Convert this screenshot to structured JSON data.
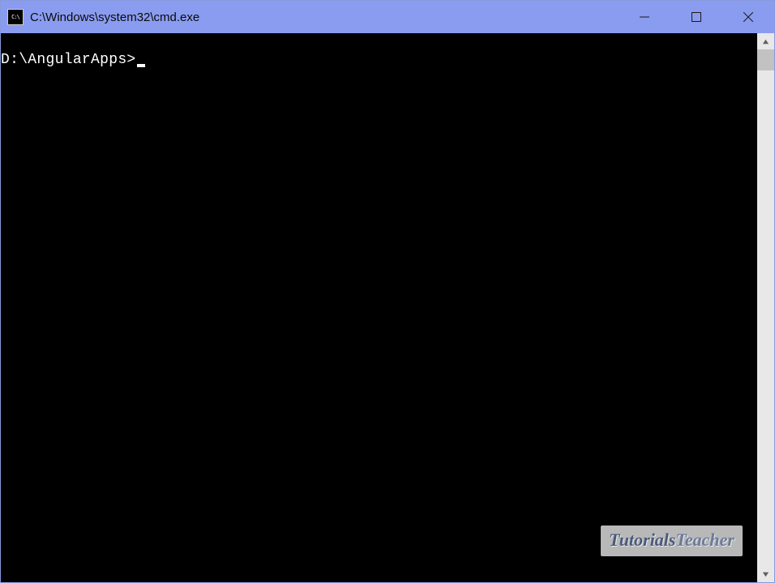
{
  "window": {
    "title": "C:\\Windows\\system32\\cmd.exe",
    "icon_glyph": "C:\\"
  },
  "terminal": {
    "prompt": "D:\\AngularApps>"
  },
  "watermark": {
    "prefix": "Tutorials",
    "suffix": "Teacher"
  }
}
